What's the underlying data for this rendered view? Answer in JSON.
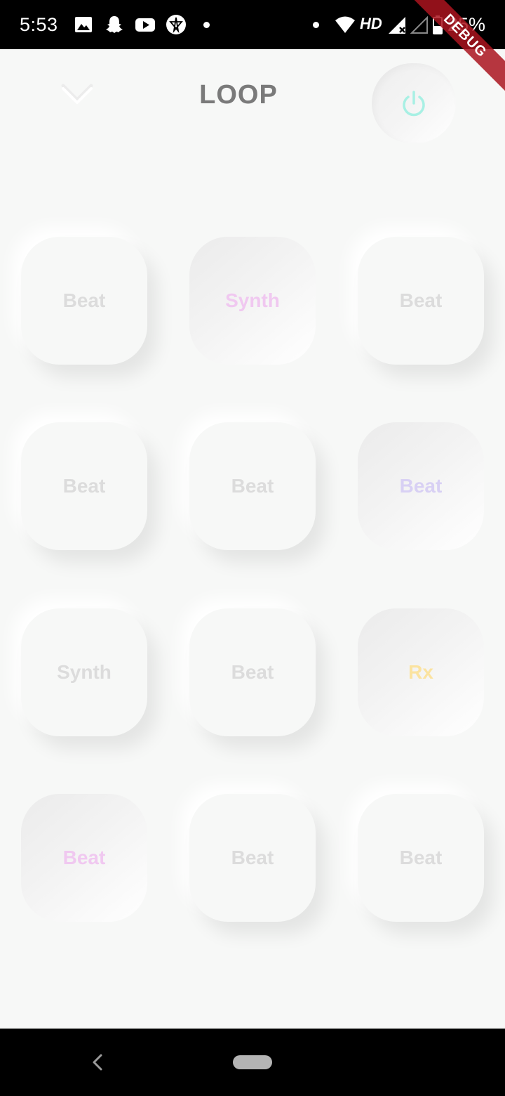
{
  "status_bar": {
    "time": "5:53",
    "network_label": "HD",
    "battery": "25%",
    "icons": [
      "image-icon",
      "snapchat-icon",
      "youtube-icon",
      "app-icon",
      "wifi-icon",
      "signal-icon",
      "signal-empty-icon",
      "battery-icon"
    ]
  },
  "debug_banner": "DEBUG",
  "header": {
    "title": "LOOP",
    "left_icon": "chevron-down-icon",
    "right_icon": "power-icon"
  },
  "pads": [
    {
      "label": "Beat",
      "active": false,
      "color": "#dcdcdc"
    },
    {
      "label": "Synth",
      "active": true,
      "color": "#f0c8f0"
    },
    {
      "label": "Beat",
      "active": false,
      "color": "#dcdcdc"
    },
    {
      "label": "Beat",
      "active": false,
      "color": "#dcdcdc"
    },
    {
      "label": "Beat",
      "active": false,
      "color": "#dcdcdc"
    },
    {
      "label": "Beat",
      "active": true,
      "color": "#d8d0f4"
    },
    {
      "label": "Synth",
      "active": false,
      "color": "#dcdcdc"
    },
    {
      "label": "Beat",
      "active": false,
      "color": "#dcdcdc"
    },
    {
      "label": "Rx",
      "active": true,
      "color": "#fbe3a0"
    },
    {
      "label": "Beat",
      "active": true,
      "color": "#f0c8f0"
    },
    {
      "label": "Beat",
      "active": false,
      "color": "#dcdcdc"
    },
    {
      "label": "Beat",
      "active": false,
      "color": "#dcdcdc"
    }
  ],
  "colors": {
    "background": "#f7f8f7",
    "title": "#7a7a7a",
    "power_accent": "#a8f0e4",
    "pad_inactive_text": "#dcdcdc"
  },
  "nav_bar": {
    "back_icon": "back-icon",
    "home_icon": "home-pill-icon"
  }
}
